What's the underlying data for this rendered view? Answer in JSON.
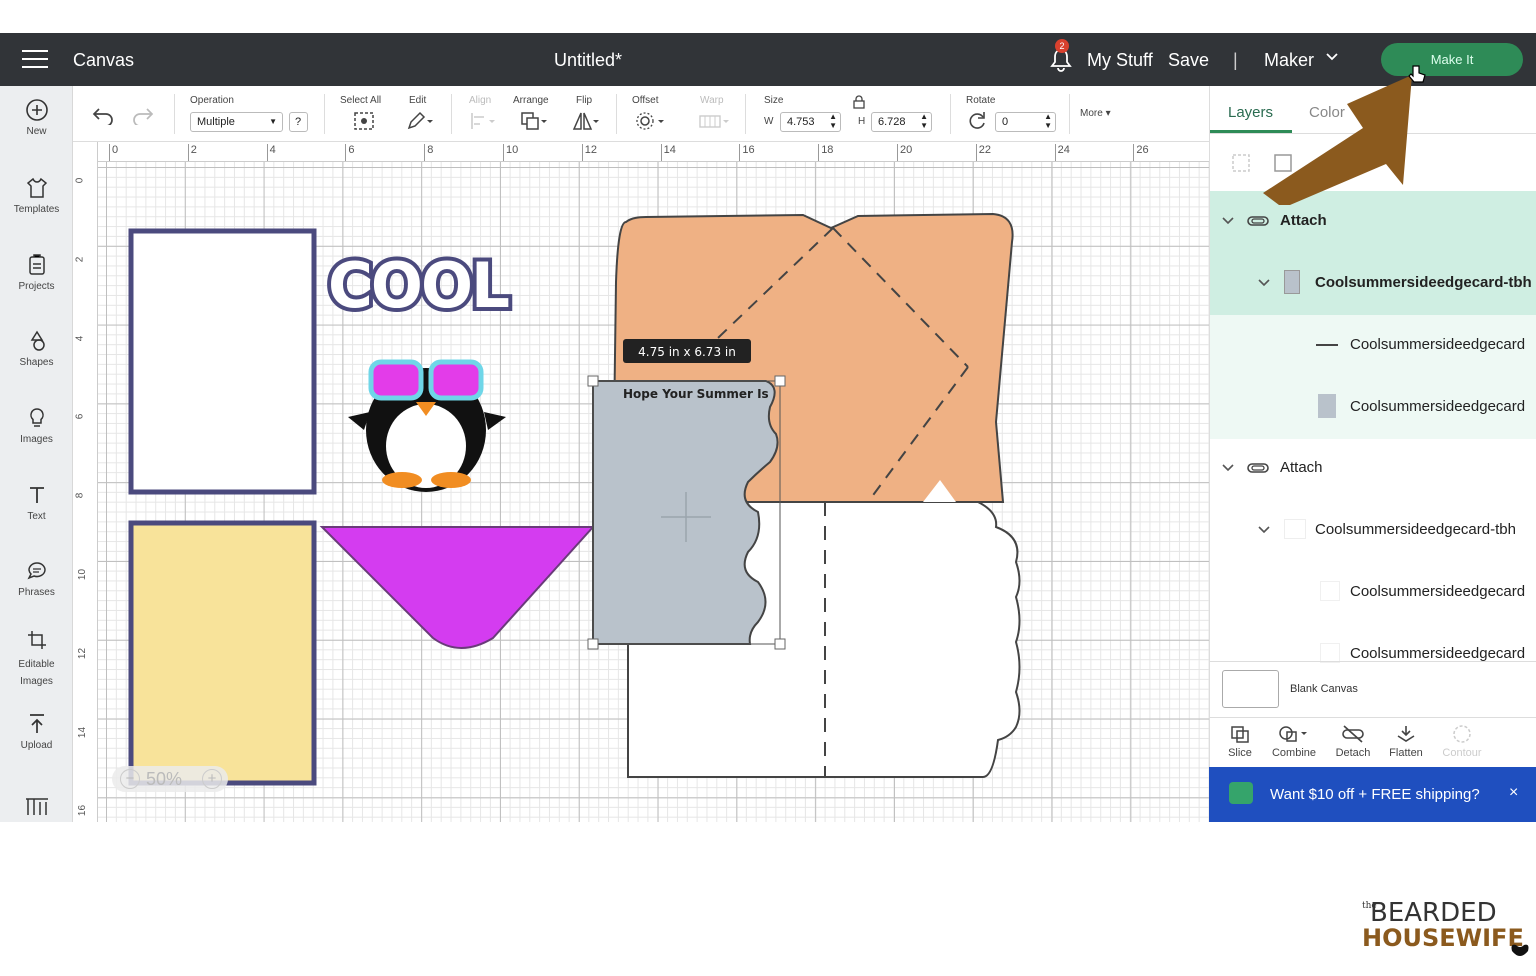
{
  "topbar": {
    "app_title": "Canvas",
    "doc_title": "Untitled*",
    "notif_count": "2",
    "my_stuff": "My Stuff",
    "save": "Save",
    "separator": "|",
    "machine": "Maker",
    "make_it": "Make It"
  },
  "sidebar": {
    "items": [
      {
        "label": "New",
        "icon": "plus-circle-icon"
      },
      {
        "label": "Templates",
        "icon": "shirt-icon"
      },
      {
        "label": "Projects",
        "icon": "projects-icon"
      },
      {
        "label": "Shapes",
        "icon": "shapes-icon"
      },
      {
        "label": "Images",
        "icon": "lightbulb-icon"
      },
      {
        "label": "Text",
        "icon": "text-icon"
      },
      {
        "label": "Phrases",
        "icon": "speech-bubble-icon"
      },
      {
        "label": "Editable Images",
        "icon": "editable-images-icon"
      },
      {
        "label": "Upload",
        "icon": "upload-icon"
      }
    ]
  },
  "toolbar": {
    "operation_label": "Operation",
    "operation_value": "Multiple",
    "operation_help": "?",
    "select_all": "Select All",
    "edit": "Edit",
    "align": "Align",
    "arrange": "Arrange",
    "flip": "Flip",
    "offset": "Offset",
    "warp": "Warp",
    "size": "Size",
    "w_label": "W",
    "w_value": "4.753",
    "h_label": "H",
    "h_value": "6.728",
    "rotate": "Rotate",
    "rotate_value": "0",
    "more": "More"
  },
  "ruler": {
    "top": [
      "0",
      "2",
      "4",
      "6",
      "8",
      "10",
      "12",
      "14",
      "16",
      "18",
      "20",
      "22",
      "24",
      "26"
    ],
    "left": [
      "0",
      "2",
      "4",
      "6",
      "8",
      "10",
      "12",
      "14",
      "16"
    ]
  },
  "canvas": {
    "cool_text": "COOL",
    "card_text": "Hope Your Summer Is",
    "size_tooltip": "4.75  in x 6.73  in",
    "zoom": "50%",
    "zoom_minus": "−",
    "zoom_plus": "+"
  },
  "layers": {
    "tab_layers": "Layers",
    "tab_color": "Color",
    "items": [
      {
        "label": "Attach"
      },
      {
        "label": "Coolsummersideedgecard-tbh"
      },
      {
        "label": "Coolsummersideedgecard"
      },
      {
        "label": "Coolsummersideedgecard"
      },
      {
        "label": "Attach"
      },
      {
        "label": "Coolsummersideedgecard-tbh"
      },
      {
        "label": "Coolsummersideedgecard"
      },
      {
        "label": "Coolsummersideedgecard"
      }
    ],
    "blank_canvas": "Blank Canvas"
  },
  "actions": {
    "slice": "Slice",
    "combine": "Combine",
    "detach": "Detach",
    "flatten": "Flatten",
    "contour": "Contour"
  },
  "promo": {
    "text": "Want $10 off + FREE shipping?",
    "close": "×"
  },
  "watermark": {
    "line1": "BEARDED",
    "line2": "HOUSEWIFE",
    "prefix": "the"
  },
  "colors": {
    "accent": "#2e8b57",
    "arrow": "#8b5a1e",
    "promo": "#1f4fbf",
    "envelope": "#efb184",
    "frame": "#4b4a7e",
    "yellow": "#f8e39a",
    "magenta": "#d43cf0",
    "gray_card": "#b9c2cb"
  }
}
